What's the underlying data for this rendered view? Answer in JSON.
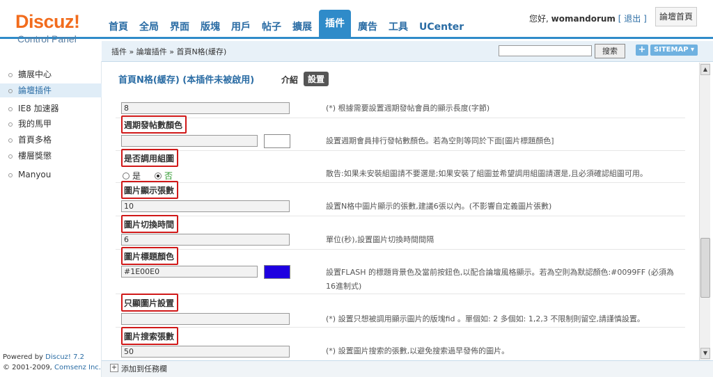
{
  "header": {
    "logo_main": "Discuz!",
    "logo_sub": "Control Panel",
    "nav": [
      "首頁",
      "全局",
      "界面",
      "版塊",
      "用戶",
      "帖子",
      "擴展",
      "插件",
      "廣告",
      "工具",
      "UCenter"
    ],
    "active_nav_index": 7,
    "greeting": "您好,",
    "username": "womandorum",
    "logout": "[ 退出 ]",
    "home_button": "論壇首頁"
  },
  "breadcrumb": {
    "text": "插件 » 論壇插件 » 首頁N格(緩存)",
    "search_button": "搜索",
    "plus_button": "+",
    "sitemap_button": "SITEMAP ▾"
  },
  "sidebar": {
    "items": [
      {
        "label": "擴展中心",
        "active": false
      },
      {
        "label": "論壇插件",
        "active": true
      },
      {
        "label": "IE8 加速器",
        "active": false
      },
      {
        "label": "我的馬甲",
        "active": false
      },
      {
        "label": "首頁多格",
        "active": false
      },
      {
        "label": "樓層獎懲",
        "active": false
      },
      {
        "label": "Manyou",
        "active": false
      }
    ],
    "powered_prefix": "Powered by ",
    "powered_brand": "Discuz! 7.2",
    "copyright_prefix": "© 2001-2009, ",
    "copyright_brand": "Comsenz Inc."
  },
  "main": {
    "title": "首頁N格(緩存) (本插件未被啟用)",
    "tab_intro": "介紹",
    "tab_settings": "設置",
    "rows": {
      "r0": {
        "value": "8",
        "desc": "(*) 根據需要設置週期發帖會員的顯示長度(字節)"
      },
      "r1": {
        "label": "週期發帖數顏色",
        "value": "",
        "swatch": "#ffffff",
        "desc": "設置週期會員排行發帖數顏色。若為空則等同於下面[圖片標題顏色]"
      },
      "r2": {
        "label": "是否調用組圖",
        "yes": "是",
        "no": "否",
        "selected": "否",
        "desc": "散告:如果未安裝組圖請不要選是;如果安裝了組圖並希望調用組圖請選是,且必須確認組圖可用。"
      },
      "r3": {
        "label": "圖片顯示張數",
        "value": "10",
        "desc": "設置N格中圖片顯示的張數,建議6張以內。(不影響自定義圖片張數)"
      },
      "r4": {
        "label": "圖片切換時間",
        "value": "6",
        "desc": "單位(秒),設置圖片切換時間間隔"
      },
      "r5": {
        "label": "圖片標題顏色",
        "value": "#1E00E0",
        "swatch": "#1E00E0",
        "desc": "設置FLASH 的標題背景色及當前按鈕色,以配合論壇風格顯示。若為空則為默認顏色:#0099FF (必須為16進制式)"
      },
      "r6": {
        "label": "只顯圖片設置",
        "value": "",
        "desc": "(*) 設置只想被調用顯示圖片的版塊fid 。單個如: 2 多個如: 1,2,3 不限制則留空,請謹慎設置。"
      },
      "r7": {
        "label": "圖片搜索張數",
        "value": "50",
        "desc": "(*) 設置圖片搜索的張數,以避免搜索過早發佈的圖片。"
      }
    }
  },
  "taskbar": {
    "plus": "+",
    "label": "添加到任務欄"
  },
  "colors": {
    "accent": "#2f8bc9",
    "logo": "#f26c1d",
    "highlight_box": "#d01818"
  }
}
